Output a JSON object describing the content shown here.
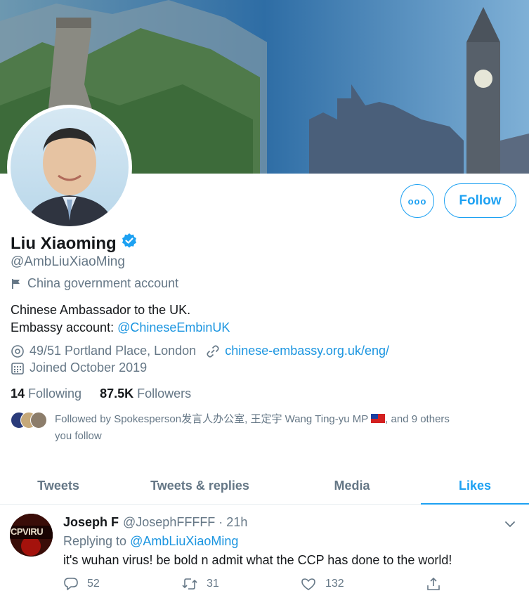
{
  "profile": {
    "name": "Liu Xiaoming",
    "handle": "@AmbLiuXiaoMing",
    "label": "China government account",
    "bio_line1": "Chinese Ambassador to the UK.",
    "bio_line2_prefix": "Embassy account: ",
    "bio_line2_link": "@ChineseEmbinUK",
    "location": "49/51 Portland Place, London",
    "website": "chinese-embassy.org.uk/eng/",
    "joined": "Joined October 2019",
    "following_count": "14",
    "following_label": "Following",
    "followers_count": "87.5K",
    "followers_label": "Followers",
    "followed_by_prefix": "Followed by Spokesperson发言人办公室, 王定宇 Wang Ting-yu MP",
    "followed_by_suffix": ", and 9 others",
    "followed_by_line2": "you follow"
  },
  "buttons": {
    "more": "ooo",
    "follow": "Follow"
  },
  "tabs": [
    {
      "label": "Tweets",
      "active": false
    },
    {
      "label": "Tweets & replies",
      "active": false
    },
    {
      "label": "Media",
      "active": false
    },
    {
      "label": "Likes",
      "active": true
    }
  ],
  "tweet": {
    "author": "Joseph F",
    "handle_time": "@JosephFFFFF · 21h",
    "reply_prefix": "Replying to ",
    "reply_handle": "@AmbLiuXiaoMing",
    "text": "it's wuhan virus! be bold n admit what the CCP has done to the world!",
    "avatar_text": "CPVIRU",
    "replies": "52",
    "retweets": "31",
    "likes": "132"
  },
  "colors": {
    "accent": "#1da1f2",
    "link": "#1b95e0",
    "secondary_text": "#657786"
  },
  "icons": [
    "verified-badge-icon",
    "flag-icon",
    "location-icon",
    "link-icon",
    "calendar-icon",
    "chevron-down-icon",
    "reply-icon",
    "retweet-icon",
    "like-icon",
    "share-icon"
  ]
}
